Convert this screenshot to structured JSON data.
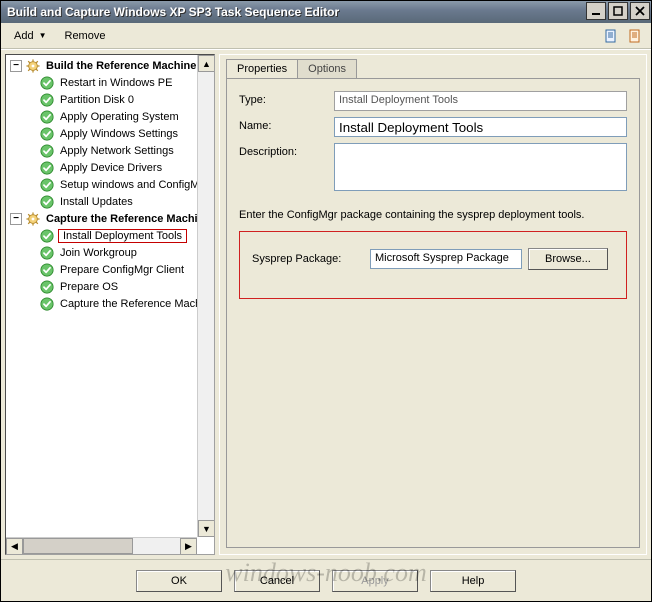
{
  "window": {
    "title": "Build and Capture Windows XP SP3 Task Sequence Editor"
  },
  "toolbar": {
    "add_label": "Add",
    "remove_label": "Remove"
  },
  "tree": {
    "groups": [
      {
        "label": "Build the Reference Machine",
        "items": [
          {
            "label": "Restart in Windows PE",
            "highlight": false
          },
          {
            "label": "Partition Disk 0",
            "highlight": false
          },
          {
            "label": "Apply Operating System",
            "highlight": false
          },
          {
            "label": "Apply Windows Settings",
            "highlight": false
          },
          {
            "label": "Apply Network Settings",
            "highlight": false
          },
          {
            "label": "Apply Device Drivers",
            "highlight": false
          },
          {
            "label": "Setup windows and ConfigMgr",
            "highlight": false
          },
          {
            "label": "Install Updates",
            "highlight": false
          }
        ]
      },
      {
        "label": "Capture the Reference Machine",
        "items": [
          {
            "label": "Install Deployment Tools",
            "highlight": true
          },
          {
            "label": "Join Workgroup",
            "highlight": false
          },
          {
            "label": "Prepare ConfigMgr Client",
            "highlight": false
          },
          {
            "label": "Prepare OS",
            "highlight": false
          },
          {
            "label": "Capture the Reference Machine",
            "highlight": false
          }
        ]
      }
    ]
  },
  "tabs": {
    "properties": "Properties",
    "options": "Options"
  },
  "form": {
    "type_label": "Type:",
    "type_value": "Install Deployment Tools",
    "name_label": "Name:",
    "name_value": "Install Deployment Tools",
    "desc_label": "Description:",
    "desc_value": "",
    "instruction": "Enter the ConfigMgr package containing the sysprep deployment tools.",
    "sysprep_label": "Sysprep Package:",
    "sysprep_value": "Microsoft Sysprep Package",
    "browse_label": "Browse..."
  },
  "footer": {
    "ok": "OK",
    "cancel": "Cancel",
    "apply": "Apply",
    "help": "Help"
  },
  "watermark": "windows-noob.com"
}
